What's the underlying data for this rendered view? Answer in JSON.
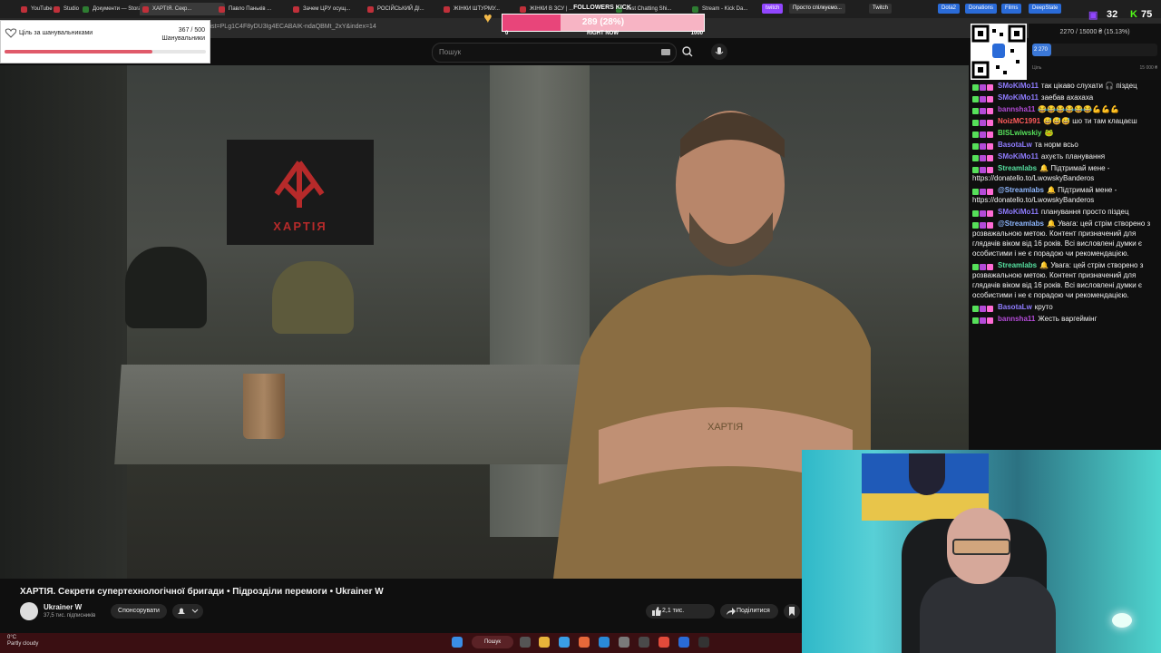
{
  "browser": {
    "tabs": [
      {
        "label": "YouTube",
        "color": "#c0303a"
      },
      {
        "label": "Studio",
        "color": "#c0303a"
      },
      {
        "label": "Документи — Storage",
        "color": "#2e7d32"
      },
      {
        "label": "ХАРТІЯ. Секр...",
        "color": "#c0303a",
        "active": true
      },
      {
        "label": "Павло Паньків ...",
        "color": "#c0303a"
      },
      {
        "label": "Зачем ЦРУ осущ...",
        "color": "#c0303a"
      },
      {
        "label": "РОСІЙСЬКИЙ ДІ...",
        "color": "#c0303a"
      },
      {
        "label": "ЖІНКИ ШТУРМУ...",
        "color": "#c0303a"
      },
      {
        "label": "ЖІНКИ В ЗСУ | ...",
        "color": "#c0303a"
      },
      {
        "label": "Just Chatting Shi...",
        "color": "#2e7d32"
      },
      {
        "label": "Stream - Kick Da...",
        "color": "#2e7d32"
      }
    ],
    "bookmarks": [
      "twitch",
      "Просто спілкуємо...",
      "Twitch",
      "Dota2",
      "Donations",
      "Films",
      "DeepState"
    ],
    "url": "list=PLg1C4F8yDU3Ig4ECABAIK-ndaQBMt_2xY&index=14"
  },
  "youtube": {
    "search_placeholder": "Пошук",
    "video_title": "ХАРТІЯ. Секрети супертехнологічної бригади • Підрозділи перемоги • Ukrainer W",
    "banner_text": "ХАРТІЯ",
    "shirt_text": "ХАРТІЯ",
    "channel_name": "Ukrainer W",
    "channel_subs": "37,5 тис. підписників",
    "sponsor_label": "Спонсорувати",
    "like_count": "2,1 тис.",
    "share_label": "Поділитися"
  },
  "taskbar": {
    "weather_temp": "0°C",
    "weather_desc": "Partly cloudy",
    "search_label": "Пошук"
  },
  "goal": {
    "title": "Ціль за шанувальниками",
    "current": "367",
    "target": "500",
    "sub": "Шанувальники",
    "progress": 0.734
  },
  "followers": {
    "title": "FOLLOWERS KICK",
    "value": "289 (28%)",
    "min": "0",
    "mid": "RIGHT NOW",
    "max": "1000",
    "progress": 0.289
  },
  "counters": {
    "left": "32",
    "right": "75"
  },
  "donations": {
    "header": "2270 / 15000 ₴ (15.13%)",
    "bar_label": "2 270",
    "min": "Ціль",
    "max": "15 000 ₴",
    "progress": 0.1513
  },
  "chat": [
    {
      "user": "SMoKiMo11",
      "color": "#8f7cff",
      "text": "так цікаво слухати 🎧 піздец"
    },
    {
      "user": "SMoKiMo11",
      "color": "#8f7cff",
      "text": "заебав ахахаха"
    },
    {
      "user": "bannsha11",
      "color": "#b44bd8",
      "text": "😂😂😂😂😂😂💪💪💪"
    },
    {
      "user": "NoizMC1991",
      "color": "#ff5b5b",
      "text": "😅😅😅 шо ти там клацаєш"
    },
    {
      "user": "BISLwiwskiy",
      "color": "#56e05a",
      "text": "🐸"
    },
    {
      "user": "BasotaLw",
      "color": "#8f7cff",
      "text": "та норм всьо"
    },
    {
      "user": "SMoKiMo11",
      "color": "#8f7cff",
      "text": "ахуєть планування"
    },
    {
      "user": "Streamlabs",
      "color": "#56e0a0",
      "text": "🔔 Підтримай мене - https://donatello.to/LwowskyBanderos"
    },
    {
      "user": "@Streamlabs",
      "color": "#8fb8ff",
      "text": "🔔 Підтримай мене - https://donatello.to/LwowskyBanderos"
    },
    {
      "user": "SMoKiMo11",
      "color": "#8f7cff",
      "text": "планування просто піздец"
    },
    {
      "user": "@Streamlabs",
      "color": "#8fb8ff",
      "text": "🔔 Увага: цей стрім створено з розважальною метою. Контент призначений для глядачів віком від 16 років. Всі висловлені думки є особистими і не є порадою чи рекомендацією."
    },
    {
      "user": "Streamlabs",
      "color": "#56e0a0",
      "text": "🔔 Увага: цей стрім створено з розважальною метою. Контент призначений для глядачів віком від 16 років. Всі висловлені думки є особистими і не є порадою чи рекомендацією."
    },
    {
      "user": "BasotaLw",
      "color": "#8f7cff",
      "text": "круто"
    },
    {
      "user": "bannsha11",
      "color": "#b44bd8",
      "text": "Жесть варгеймінг"
    }
  ]
}
